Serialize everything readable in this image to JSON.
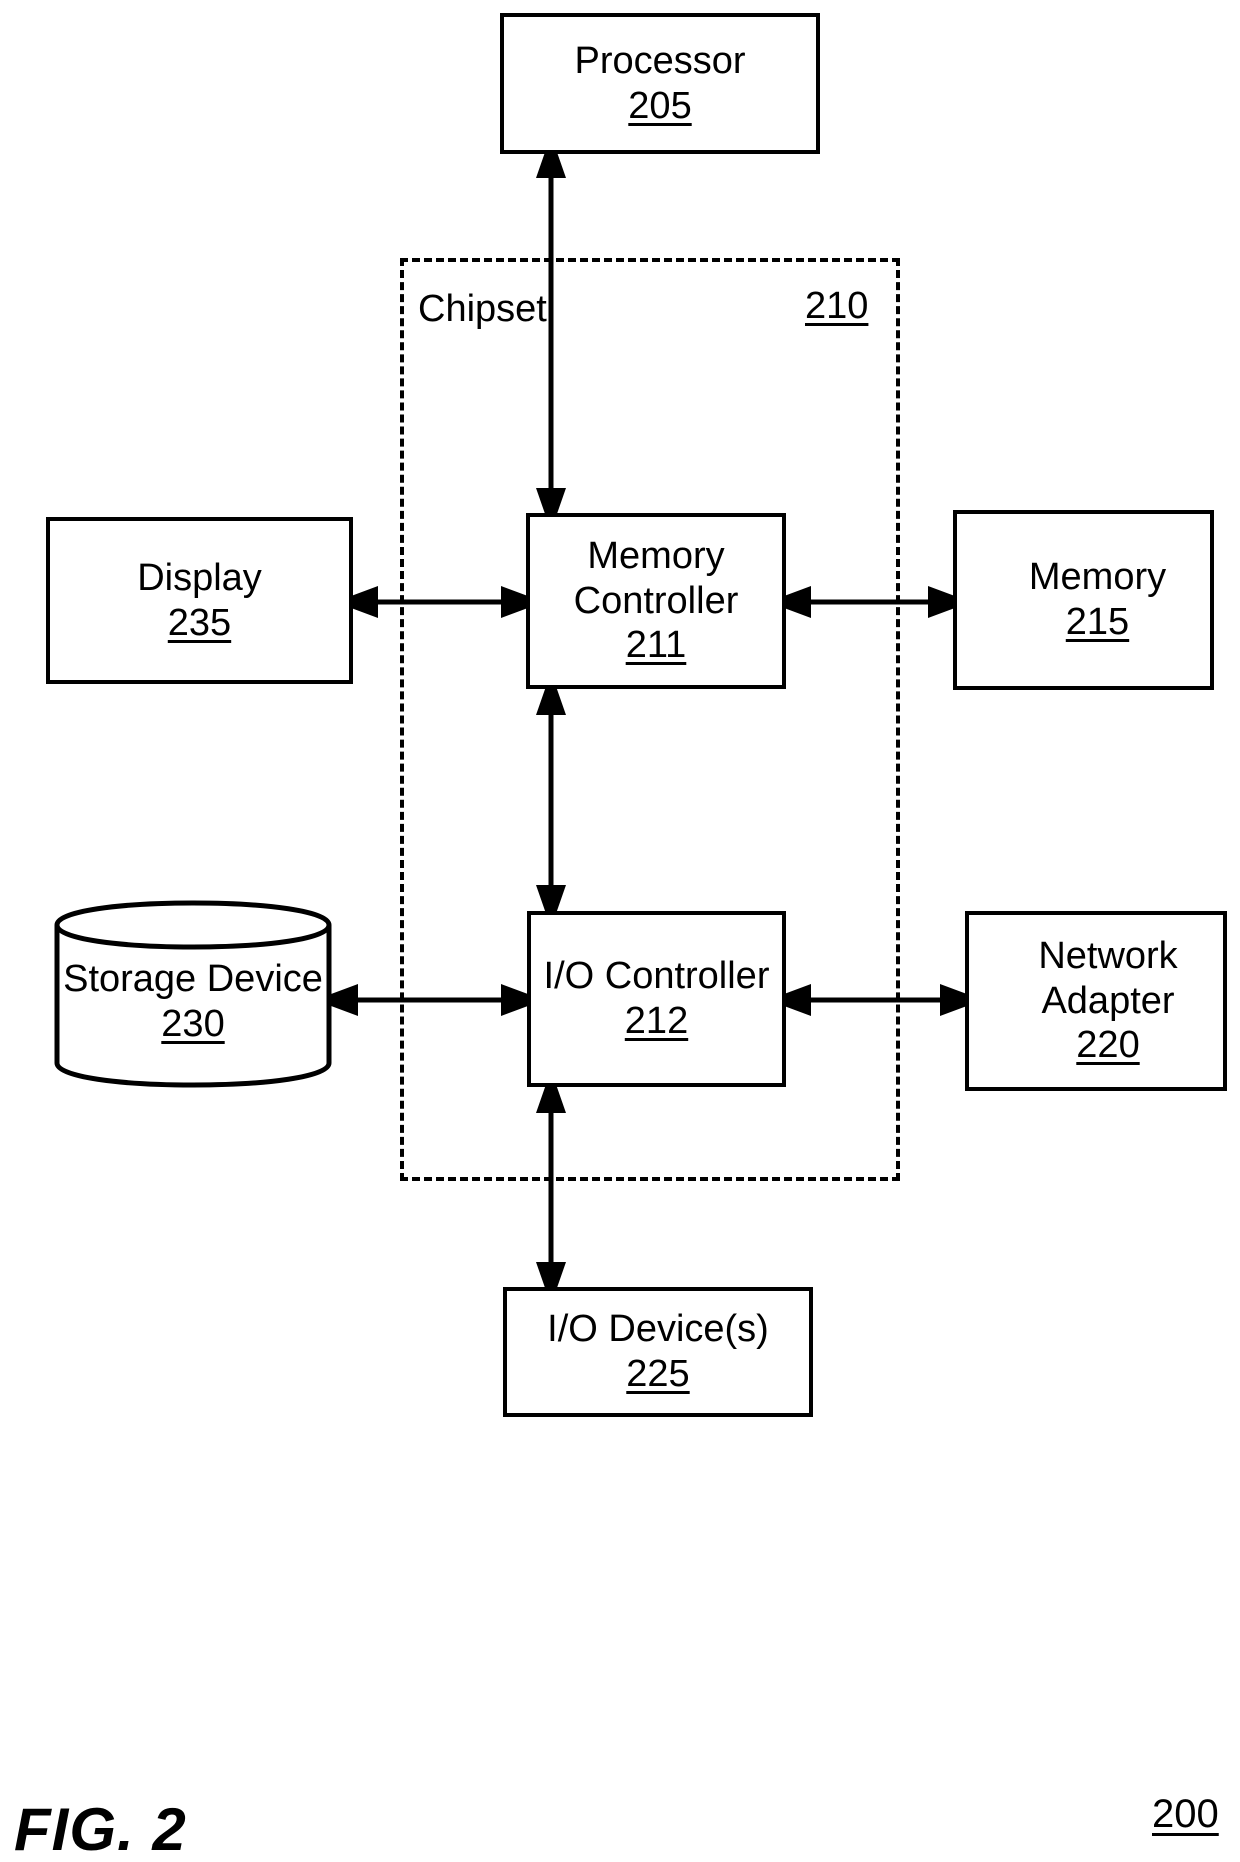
{
  "figure": {
    "caption": "FIG. 2",
    "reference_numeral": "200"
  },
  "chipset": {
    "label": "Chipset",
    "reference_numeral": "210"
  },
  "nodes": {
    "processor": {
      "label": "Processor",
      "reference_numeral": "205"
    },
    "memory_controller": {
      "label_line1": "Memory",
      "label_line2": "Controller",
      "reference_numeral": "211"
    },
    "io_controller": {
      "label": "I/O Controller",
      "reference_numeral": "212"
    },
    "display": {
      "label": "Display",
      "reference_numeral": "235"
    },
    "memory": {
      "label": "Memory",
      "reference_numeral": "215"
    },
    "storage_device": {
      "label": "Storage Device",
      "reference_numeral": "230"
    },
    "network_adapter": {
      "label_line1": "Network",
      "label_line2": "Adapter",
      "reference_numeral": "220"
    },
    "io_devices": {
      "label": "I/O Device(s)",
      "reference_numeral": "225"
    }
  },
  "connections": [
    {
      "from": "memory_controller",
      "to": "processor",
      "style": "double-arrow",
      "orientation": "vertical"
    },
    {
      "from": "display",
      "to": "memory_controller",
      "style": "double-arrow",
      "orientation": "horizontal"
    },
    {
      "from": "memory_controller",
      "to": "memory",
      "style": "double-arrow",
      "orientation": "horizontal"
    },
    {
      "from": "memory_controller",
      "to": "io_controller",
      "style": "double-arrow",
      "orientation": "vertical"
    },
    {
      "from": "storage_device",
      "to": "io_controller",
      "style": "double-arrow",
      "orientation": "horizontal"
    },
    {
      "from": "io_controller",
      "to": "network_adapter",
      "style": "double-arrow",
      "orientation": "horizontal"
    },
    {
      "from": "io_controller",
      "to": "io_devices",
      "style": "double-arrow",
      "orientation": "vertical"
    }
  ],
  "colors": {
    "stroke": "#000000",
    "background": "#ffffff"
  }
}
